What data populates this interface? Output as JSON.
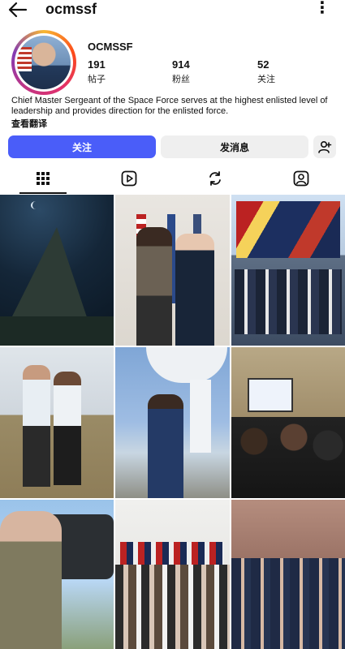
{
  "header": {
    "handle": "ocmssf",
    "back_icon": "arrow-left-icon",
    "more_icon": "more-vertical-icon"
  },
  "profile": {
    "display_name": "OCMSSF",
    "stats": [
      {
        "value": "191",
        "label": "帖子"
      },
      {
        "value": "914",
        "label": "粉丝"
      },
      {
        "value": "52",
        "label": "关注"
      }
    ],
    "bio": "Chief Master Sergeant of the Space Force serves at the highest enlisted level of leadership and provides direction for the enlisted force.",
    "translate_label": "查看翻译"
  },
  "actions": {
    "follow_label": "关注",
    "message_label": "发消息",
    "add_user_icon": "add-person-icon"
  },
  "tabs": [
    {
      "icon": "grid-icon",
      "active": true
    },
    {
      "icon": "reels-icon",
      "active": false
    },
    {
      "icon": "reposts-icon",
      "active": false
    },
    {
      "icon": "tagged-icon",
      "active": false
    }
  ],
  "colors": {
    "accent": "#4a5df9",
    "button_bg": "#efefef",
    "text": "#111111"
  }
}
